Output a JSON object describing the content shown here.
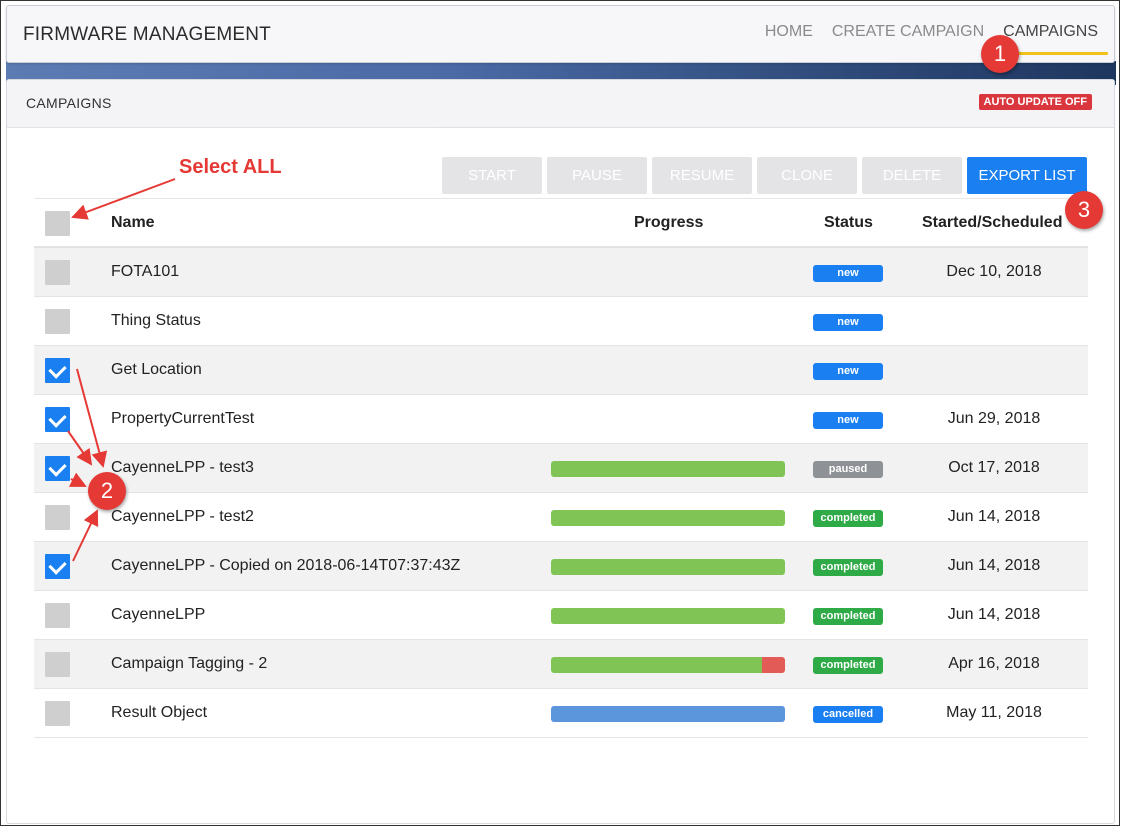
{
  "app": {
    "title": "FIRMWARE MANAGEMENT"
  },
  "nav": [
    {
      "label": "HOME",
      "active": false
    },
    {
      "label": "CREATE CAMPAIGN",
      "active": false
    },
    {
      "label": "CAMPAIGNS",
      "active": true
    }
  ],
  "panel": {
    "title": "CAMPAIGNS",
    "auto_update": "AUTO UPDATE OFF"
  },
  "toolbar": {
    "start": "START",
    "pause": "PAUSE",
    "resume": "RESUME",
    "clone": "CLONE",
    "delete": "DELETE",
    "export": "EXPORT LIST"
  },
  "table": {
    "headers": {
      "name": "Name",
      "progress": "Progress",
      "status": "Status",
      "started": "Started/Scheduled"
    },
    "rows": [
      {
        "name": "FOTA101",
        "status": "new",
        "date": "Dec 10, 2018",
        "checked": false,
        "progress": null
      },
      {
        "name": "Thing Status",
        "status": "new",
        "date": "",
        "checked": false,
        "progress": null
      },
      {
        "name": "Get Location",
        "status": "new",
        "date": "",
        "checked": true,
        "progress": null
      },
      {
        "name": "PropertyCurrentTest",
        "status": "new",
        "date": "Jun 29, 2018",
        "checked": true,
        "progress": null
      },
      {
        "name": "CayenneLPP - test3",
        "status": "paused",
        "date": "Oct 17, 2018",
        "checked": true,
        "progress": {
          "success": 1.0,
          "failed": 0
        }
      },
      {
        "name": "CayenneLPP - test2",
        "status": "completed",
        "date": "Jun 14, 2018",
        "checked": false,
        "progress": {
          "success": 1.0,
          "failed": 0
        }
      },
      {
        "name": "CayenneLPP - Copied on 2018-06-14T07:37:43Z",
        "status": "completed",
        "date": "Jun 14, 2018",
        "checked": true,
        "progress": {
          "success": 1.0,
          "failed": 0
        }
      },
      {
        "name": "CayenneLPP",
        "status": "completed",
        "date": "Jun 14, 2018",
        "checked": false,
        "progress": {
          "success": 1.0,
          "failed": 0
        }
      },
      {
        "name": "Campaign Tagging - 2",
        "status": "completed",
        "date": "Apr 16, 2018",
        "checked": false,
        "progress": {
          "success": 0.9,
          "failed": 0.1
        }
      },
      {
        "name": "Result Object",
        "status": "cancelled",
        "date": "May 11, 2018",
        "checked": false,
        "progress": {
          "cancelled": 1.0
        }
      }
    ]
  },
  "colors": {
    "status_new": "#1a7ff0",
    "status_paused": "#8e9296",
    "status_completed": "#2eaa47",
    "status_cancelled": "#1a7ff0",
    "bar_success": "#7fc454",
    "bar_failed": "#e25b57",
    "bar_cancelled": "#5b95dc",
    "accent": "#1a7ff0",
    "annotation": "#e53935"
  },
  "annotations": {
    "select_all": "Select ALL",
    "callout_1": "1",
    "callout_2": "2",
    "callout_3": "3"
  }
}
